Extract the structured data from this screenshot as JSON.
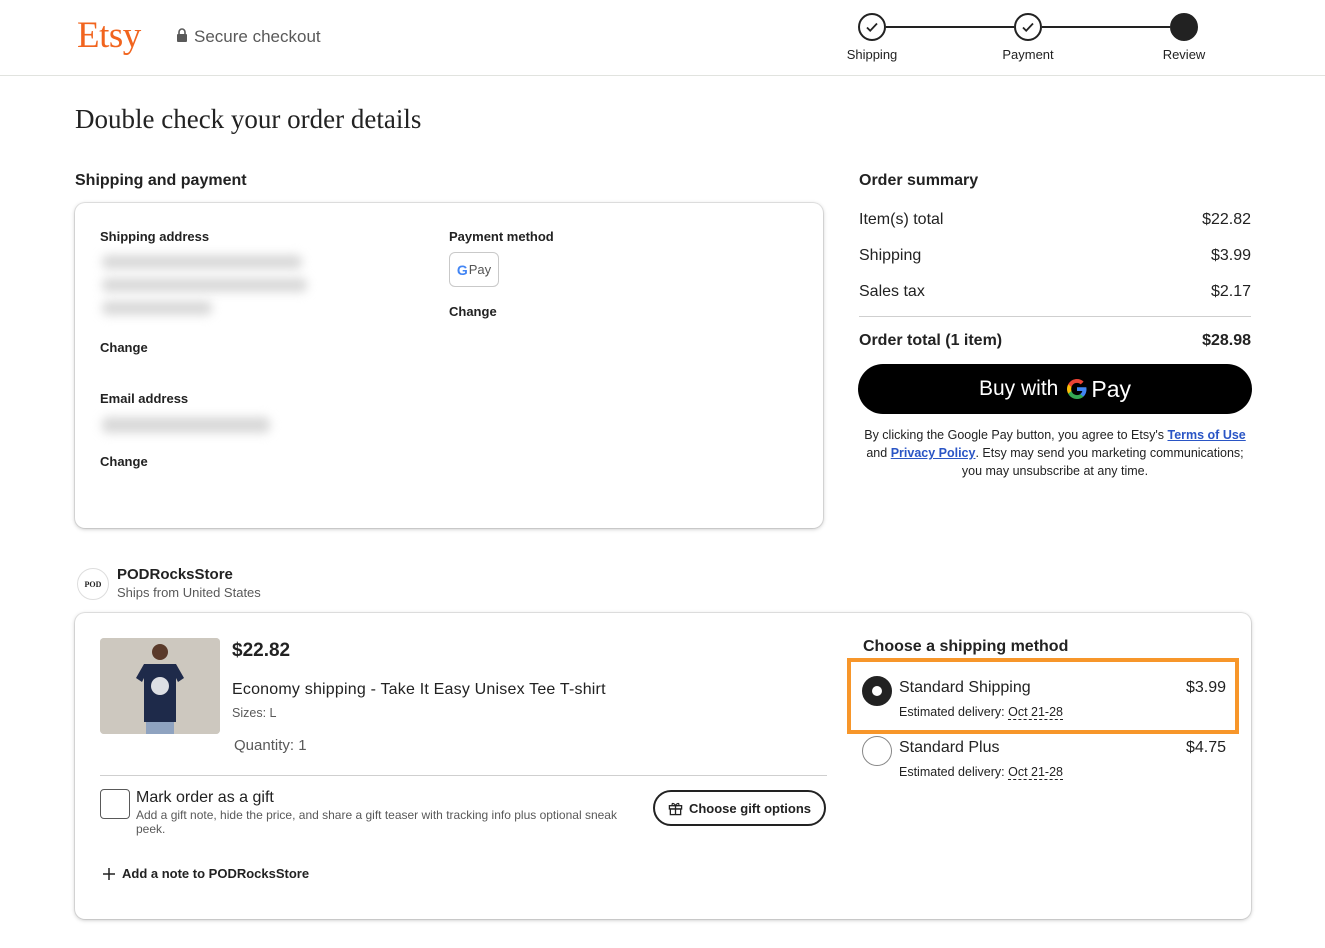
{
  "header": {
    "logo": "Etsy",
    "secure_label": "Secure checkout",
    "steps": [
      {
        "label": "Shipping",
        "state": "done"
      },
      {
        "label": "Payment",
        "state": "done"
      },
      {
        "label": "Review",
        "state": "current"
      }
    ]
  },
  "page_title": "Double check your order details",
  "shipping_payment": {
    "title": "Shipping and payment",
    "shipping_address_label": "Shipping address",
    "payment_method_label": "Payment method",
    "payment_badge": {
      "g": "G",
      "text": "Pay"
    },
    "change_label": "Change",
    "email_label": "Email address"
  },
  "order_summary": {
    "title": "Order summary",
    "rows": [
      {
        "label": "Item(s) total",
        "value": "$22.82"
      },
      {
        "label": "Shipping",
        "value": "$3.99"
      },
      {
        "label": "Sales tax",
        "value": "$2.17"
      }
    ],
    "total_label": "Order total (1 item)",
    "total_value": "$28.98",
    "buy_button": {
      "prefix": "Buy with",
      "g": "G",
      "pay": "Pay"
    },
    "legal": {
      "before": "By clicking the Google Pay button, you agree to Etsy's ",
      "terms": "Terms of Use",
      "and": " and ",
      "privacy": "Privacy Policy",
      "after": ". Etsy may send you marketing communications; you may unsubscribe at any time."
    }
  },
  "shop": {
    "avatar_text": "POD",
    "name": "PODRocksStore",
    "ships_from": "Ships from United States"
  },
  "item": {
    "price": "$22.82",
    "title": "Economy shipping - Take It Easy Unisex Tee T-shirt",
    "size": "Sizes: L",
    "quantity": "Quantity: 1",
    "gift_title": "Mark order as a gift",
    "gift_desc": "Add a gift note, hide the price, and share a gift teaser with tracking info plus optional sneak peek.",
    "gift_button": "Choose gift options",
    "add_note": "Add a note to PODRocksStore"
  },
  "shipping_methods": {
    "title": "Choose a shipping method",
    "options": [
      {
        "name": "Standard Shipping",
        "price": "$3.99",
        "est_label": "Estimated delivery:",
        "date": "Oct 21-28",
        "selected": true
      },
      {
        "name": "Standard Plus",
        "price": "$4.75",
        "est_label": "Estimated delivery:",
        "date": "Oct 21-28",
        "selected": false
      }
    ]
  },
  "colors": {
    "brand": "#f1641e",
    "highlight": "#f7962a",
    "link": "#2a55c5"
  }
}
